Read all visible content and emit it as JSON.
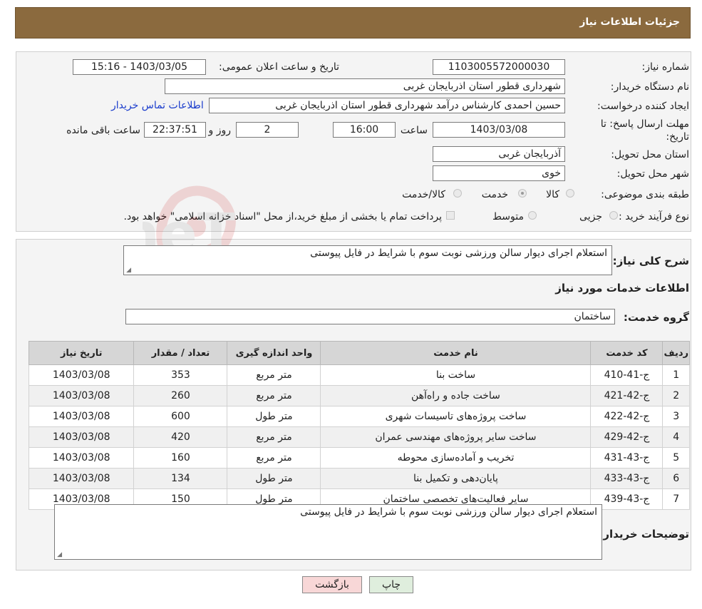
{
  "header": {
    "title": "جزئیات اطلاعات نیاز"
  },
  "details": {
    "need_number_label": "شماره نیاز:",
    "need_number": "1103005572000030",
    "announce_label": "تاریخ و ساعت اعلان عمومی:",
    "announce_value": "1403/03/05 - 15:16",
    "buyer_org_label": "نام دستگاه خریدار:",
    "buyer_org": "شهرداری قطور استان اذربایجان غربی",
    "creator_label": "ایجاد کننده درخواست:",
    "creator": "حسین احمدی کارشناس درآمد شهرداری قطور استان اذربایجان غربی",
    "contact_link": "اطلاعات تماس خریدار",
    "deadline_label": "مهلت ارسال پاسخ: تا تاریخ:",
    "deadline_date": "1403/03/08",
    "time_label": "ساعت",
    "deadline_time": "16:00",
    "days_value": "2",
    "days_label": "روز و",
    "remaining_value": "22:37:51",
    "remaining_label": "ساعت باقی مانده",
    "province_label": "استان محل تحویل:",
    "province": "آذربایجان غربی",
    "city_label": "شهر محل تحویل:",
    "city": "خوی",
    "category_label": "طبقه بندی موضوعی:",
    "category_options": [
      "کالا",
      "خدمت",
      "کالا/خدمت"
    ],
    "category_selected": "خدمت",
    "process_label": "نوع فرآیند خرید :",
    "process_options": [
      "جزیی",
      "متوسط"
    ],
    "payment_note": "پرداخت تمام یا بخشی از مبلغ خرید،از محل \"اسناد خزانه اسلامی\" خواهد بود."
  },
  "summary": {
    "label": "شرح کلی نیاز:",
    "text": "استعلام اجرای دیوار سالن ورزشی نوبت سوم با شرایط در فایل پیوستی"
  },
  "services": {
    "section_title": "اطلاعات خدمات مورد نیاز",
    "group_label": "گروه خدمت:",
    "group_value": "ساختمان",
    "columns": [
      "ردیف",
      "کد خدمت",
      "نام خدمت",
      "واحد اندازه گیری",
      "تعداد / مقدار",
      "تاریخ نیاز"
    ],
    "rows": [
      [
        "1",
        "ج-41-410",
        "ساخت بنا",
        "متر مربع",
        "353",
        "1403/03/08"
      ],
      [
        "2",
        "ج-42-421",
        "ساخت جاده و راه‌آهن",
        "متر مربع",
        "260",
        "1403/03/08"
      ],
      [
        "3",
        "ج-42-422",
        "ساخت پروژه‌های تاسیسات شهری",
        "متر طول",
        "600",
        "1403/03/08"
      ],
      [
        "4",
        "ج-42-429",
        "ساخت سایر پروژه‌های مهندسی عمران",
        "متر مربع",
        "420",
        "1403/03/08"
      ],
      [
        "5",
        "ج-43-431",
        "تخریب و آماده‌سازی محوطه",
        "متر مربع",
        "160",
        "1403/03/08"
      ],
      [
        "6",
        "ج-43-433",
        "پایان‌دهی و تکمیل بنا",
        "متر طول",
        "134",
        "1403/03/08"
      ],
      [
        "7",
        "ج-43-439",
        "سایر فعالیت‌های تخصصی ساختمان",
        "متر طول",
        "150",
        "1403/03/08"
      ]
    ]
  },
  "buyer_notes": {
    "label": "توضیحات خریدار:",
    "text": "استعلام اجرای دیوار سالن ورزشی نوبت سوم با شرایط در فایل پیوستی"
  },
  "buttons": {
    "print": "چاپ",
    "back": "بازگشت"
  },
  "watermark": {
    "text": "AriaTender.neT"
  },
  "colors": {
    "header_bg": "#8b6a3e",
    "link": "#1a3ccc",
    "back_button": "#f8d7d7",
    "print_button": "#dfeedd"
  }
}
